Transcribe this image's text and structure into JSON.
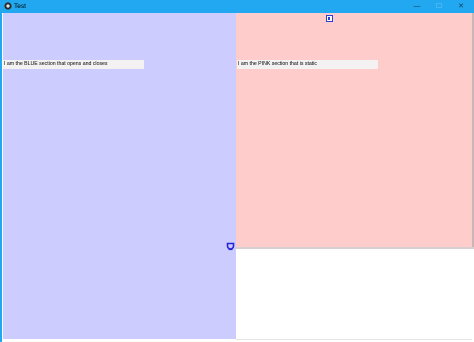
{
  "window": {
    "title": "Test",
    "icons": {
      "app": "app-logo-icon",
      "minimize": "minimize-icon",
      "maximize": "maximize-icon",
      "close": "close-icon"
    },
    "controls": {
      "minimize": "—",
      "maximize": "☐",
      "close": "✕"
    },
    "titlebar_color": "#21a8f0"
  },
  "blue_section": {
    "label": "I am the BLUE section that opens and closes",
    "color": "#ccccff"
  },
  "pink_section": {
    "label": "I am the PINK section that is static",
    "color": "#ffcccc"
  },
  "toggle": {
    "icon": "toggle-panel-icon",
    "accent": "#2d3fd6"
  },
  "collapse": {
    "icon": "collapse-arrow-icon"
  }
}
